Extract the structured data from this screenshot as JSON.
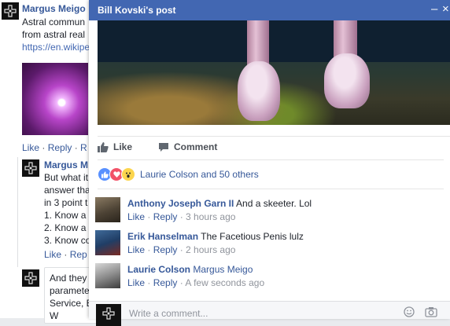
{
  "background_feed": {
    "post_author": "Margus Meigo",
    "post_lines": [
      "Astral commun",
      "from astral real"
    ],
    "post_link": "https://en.wikipe",
    "actions": [
      "Like",
      "Reply",
      "R"
    ],
    "reply_author": "Margus M",
    "reply_lines": [
      "But what it",
      "answer tha",
      "in 3 point t",
      "1. Know a",
      "2. Know a",
      "3. Know co"
    ],
    "reply_actions": [
      "Like",
      "Rep"
    ],
    "reply_box_lines": [
      "And they",
      "paramete",
      "Service, E",
      "W"
    ]
  },
  "post_window": {
    "title": "Bill Kovski's post",
    "minimize_label": "–",
    "close_label": "×",
    "actions": {
      "like": "Like",
      "comment": "Comment"
    },
    "reactions": {
      "icons": [
        "like-reaction",
        "love-reaction",
        "wow-reaction"
      ],
      "summary": "Laurie Colson and 50 others"
    },
    "comments": [
      {
        "name": "Anthony Joseph Garn II",
        "text": "And a skeeter. Lol",
        "like": "Like",
        "reply": "Reply",
        "time": "3 hours ago"
      },
      {
        "name": "Erik Hanselman",
        "text": "The Facetious Penis lulz",
        "like": "Like",
        "reply": "Reply",
        "time": "2 hours ago"
      },
      {
        "name": "Laurie Colson",
        "text": "Margus Meigo",
        "like": "Like",
        "reply": "Reply",
        "time": "A few seconds ago"
      }
    ],
    "composer": {
      "placeholder": "Write a comment..."
    },
    "colors": {
      "header": "#4267b2",
      "link": "#365899",
      "meta": "#90949c"
    }
  }
}
